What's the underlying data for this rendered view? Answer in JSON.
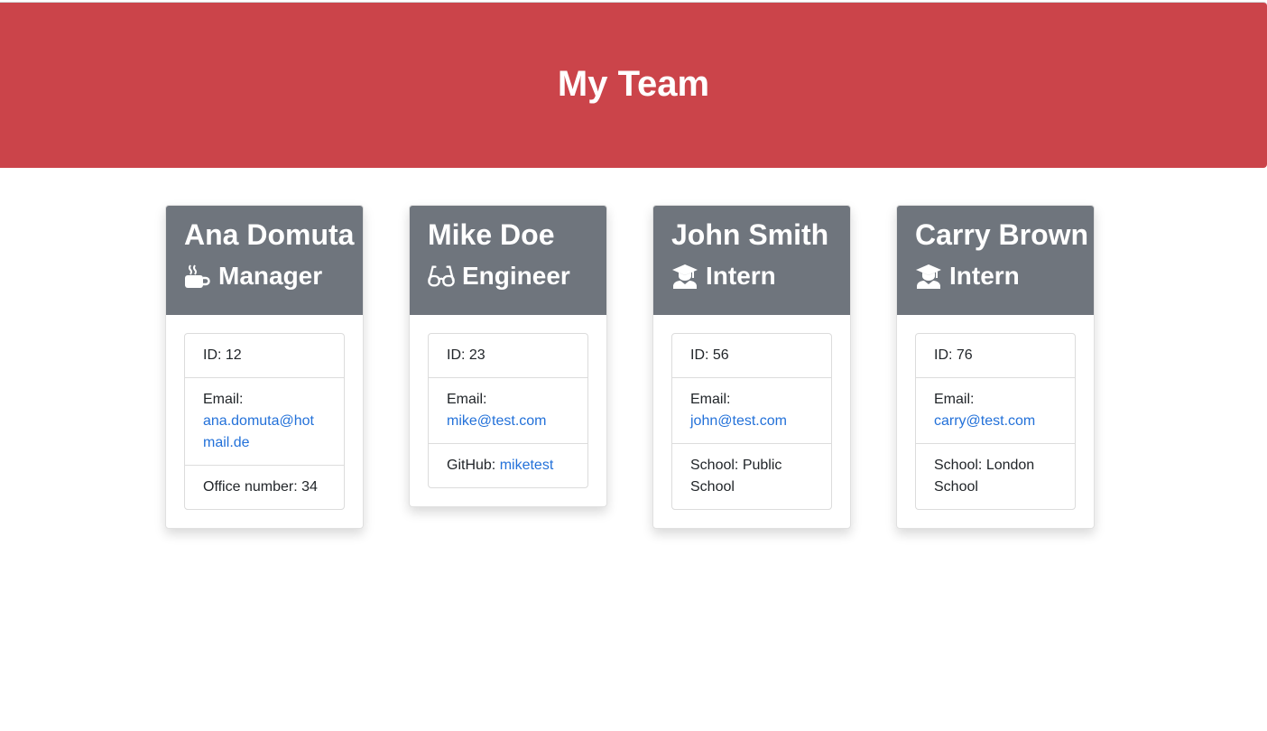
{
  "header": {
    "title": "My Team"
  },
  "team": [
    {
      "name": "Ana Domuta",
      "role": "Manager",
      "icon": "coffee-icon",
      "id_text": "ID: 12",
      "email_label": "Email:",
      "email": "ana.domuta@hotmail.de",
      "extra_label": "Office number: 34",
      "extra_value": ""
    },
    {
      "name": "Mike Doe",
      "role": "Engineer",
      "icon": "glasses-icon",
      "id_text": "ID: 23",
      "email_label": "Email:",
      "email": "mike@test.com",
      "extra_label": "GitHub: ",
      "extra_value": "miketest"
    },
    {
      "name": "John Smith",
      "role": "Intern",
      "icon": "graduate-icon",
      "id_text": "ID: 56",
      "email_label": "Email:",
      "email": "john@test.com",
      "extra_label": "School: Public School",
      "extra_value": ""
    },
    {
      "name": "Carry Brown",
      "role": "Intern",
      "icon": "graduate-icon",
      "id_text": "ID: 76",
      "email_label": "Email:",
      "email": "carry@test.com",
      "extra_label": "School: London School",
      "extra_value": ""
    }
  ],
  "colors": {
    "header_bg": "#cb444a",
    "card_head_bg": "#6f757d",
    "link": "#2371d9"
  }
}
